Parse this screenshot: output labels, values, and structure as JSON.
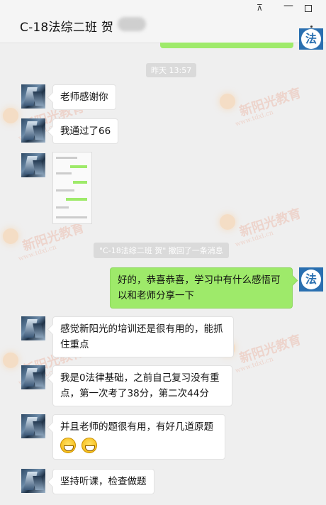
{
  "window": {
    "title": "C-18法综二班 贺",
    "pin_icon": "pin-icon",
    "minimize_icon": "minimize-icon",
    "maximize_icon": "maximize-icon",
    "more_icon": "more-icon"
  },
  "watermark": {
    "text": "新阳光教育",
    "url": "www.tdxl.cn"
  },
  "messages": {
    "timestamp": "昨天 13:57",
    "m1": "老师感谢你",
    "m2": "我通过了66",
    "system": "\"C-18法综二班 贺\" 撤回了一条消息",
    "m3": "好的，恭喜恭喜，学习中有什么感悟可以和老师分享一下",
    "m4": "感觉新阳光的培训还是很有用的，能抓住重点",
    "m5": "我是0法律基础，之前自己复习没有重点，第一次考了38分，第二次44分",
    "m6": "并且老师的题很有用，有好几道原题",
    "m7": "坚持听课，检查做题"
  },
  "self_avatar": {
    "glyph": "法",
    "color": "#2a6fb0"
  },
  "colors": {
    "bubble_self": "#9eea6a",
    "background": "#efefef"
  }
}
